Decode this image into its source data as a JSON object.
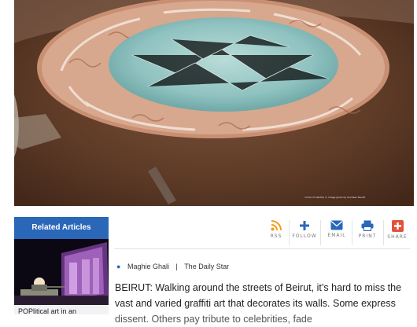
{
  "hero": {
    "caption": "Circle of identity 3, image given by Sundeer Kanafi"
  },
  "related": {
    "header": "Related Articles",
    "article_title": "POPlitical art in an"
  },
  "share": {
    "rss_label": "RSS",
    "follow_label": "FOLLOW",
    "email_label": "EMAIL",
    "print_label": "PRINT",
    "share_label": "SHARE",
    "accent_rss": "#f39c12",
    "accent_blue": "#2a67b8",
    "accent_share": "#e0533b"
  },
  "byline": {
    "author": "Maghie Ghali",
    "source": "The Daily Star"
  },
  "article": {
    "line1": "BEIRUT: Walking around the streets of Beirut, it’s hard to miss the",
    "line2": "vast and varied graffiti art that decorates its walls. Some express",
    "line3": "dissent. Others pay tribute to celebrities, fade"
  }
}
